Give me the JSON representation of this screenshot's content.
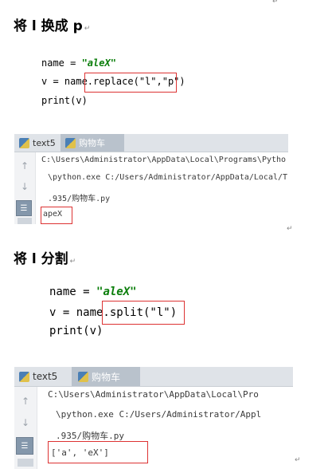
{
  "section1": {
    "heading": "将 l 换成 p",
    "code": {
      "line1": {
        "var": "name = ",
        "str": "\"aleX\""
      },
      "line2": {
        "plain": "v = name.",
        "call": "replace(\"l\",\"p\")"
      },
      "line3": "print(v)"
    },
    "tabs": [
      "text5",
      "购物车"
    ],
    "console": {
      "line1": "C:\\Users\\Administrator\\AppData\\Local\\Programs\\Pytho",
      "line2": "\\python.exe C:/Users/Administrator/AppData/Local/T",
      "line3": ".935/购物车.py",
      "output": "apeX"
    }
  },
  "section2": {
    "heading": "将 l 分割",
    "code": {
      "line1": {
        "var": "name = ",
        "str": "\"aleX\""
      },
      "line2": {
        "plain": "v = name.",
        "call": "split(\"l\")"
      },
      "line3": "print(v)"
    },
    "tabs": [
      "text5",
      "购物车"
    ],
    "console": {
      "line1": "C:\\Users\\Administrator\\AppData\\Local\\Pro",
      "line2": "\\python.exe C:/Users/Administrator/Appl",
      "line3": ".935/购物车.py",
      "output": "['a', 'eX']"
    }
  },
  "icons": {
    "para_mark": "↵",
    "up_arrow": "arrow-up-icon",
    "down_arrow": "arrow-down-icon",
    "wrap": "soft-wrap-icon"
  },
  "colors": {
    "string": "#0b7e0b",
    "highlight_box": "#d33333",
    "tab_bar": "#dfe3e8",
    "active_tab": "#b9c2cc"
  }
}
